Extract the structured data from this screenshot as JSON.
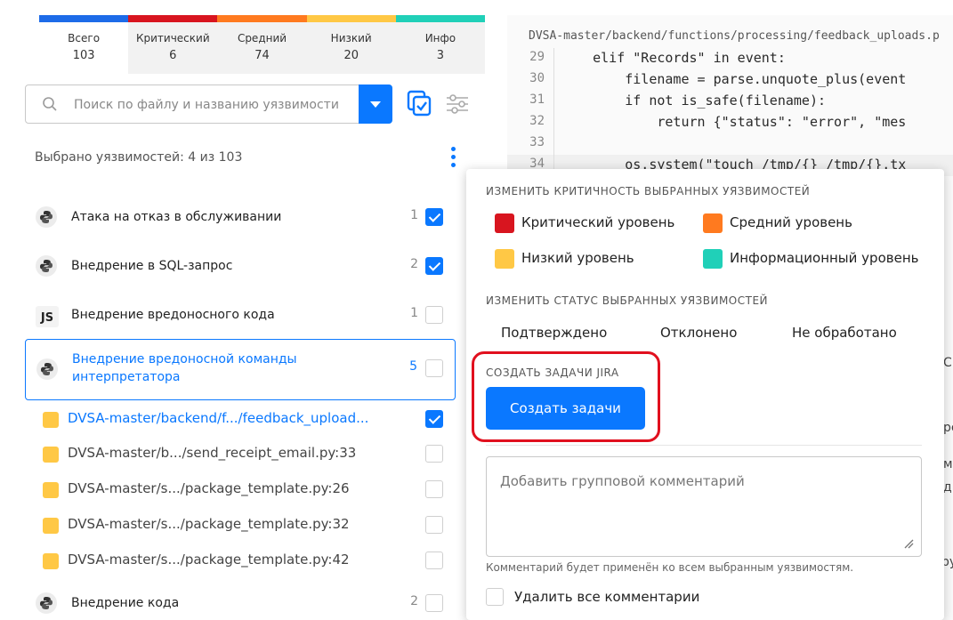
{
  "severity_tabs": [
    {
      "label": "Всего",
      "count": "103",
      "color": "#1d6be8"
    },
    {
      "label": "Критический",
      "count": "6",
      "color": "#d8151f"
    },
    {
      "label": "Средний",
      "count": "74",
      "color": "#ff7a1f"
    },
    {
      "label": "Низкий",
      "count": "20",
      "color": "#ffc845"
    },
    {
      "label": "Инфо",
      "count": "3",
      "color": "#20d0b8"
    }
  ],
  "search": {
    "placeholder": "Поиск по файлу и названию уязвимости"
  },
  "selected_info": "Выбрано уязвимостей: 4 из 103",
  "vulns": [
    {
      "name": "Атака на отказ в обслуживании",
      "count": "1",
      "icon": "python-icon",
      "checked": true
    },
    {
      "name": "Внедрение в SQL-запрос",
      "count": "2",
      "icon": "python-icon",
      "checked": true
    },
    {
      "name": "Внедрение вредоносного кода",
      "count": "1",
      "icon": "js-icon",
      "icon_text": "JS",
      "checked": false
    },
    {
      "name": "Внедрение вредоносной команды интерпретатора",
      "count": "5",
      "icon": "python-icon",
      "checked": false
    },
    {
      "name": "Внедрение кода",
      "count": "2",
      "icon": "python-icon",
      "checked": false
    }
  ],
  "files": [
    {
      "name": "DVSA-master/backend/f.../feedback_upload...",
      "checked": true
    },
    {
      "name": "DVSA-master/b.../send_receipt_email.py:33",
      "checked": false
    },
    {
      "name": "DVSA-master/s.../package_template.py:26",
      "checked": false
    },
    {
      "name": "DVSA-master/s.../package_template.py:32",
      "checked": false
    },
    {
      "name": "DVSA-master/s.../package_template.py:42",
      "checked": false
    }
  ],
  "code": {
    "path": "DVSA-master/backend/functions/processing/feedback_uploads.p",
    "lines": [
      {
        "num": "29",
        "text": "    elif \"Records\" in event:"
      },
      {
        "num": "30",
        "text": "        filename = parse.unquote_plus(event"
      },
      {
        "num": "31",
        "text": "        if not is_safe(filename):"
      },
      {
        "num": "32",
        "text": "            return {\"status\": \"error\", \"mes"
      },
      {
        "num": "33",
        "text": ""
      },
      {
        "num": "34",
        "text": "        os.system(\"touch /tmp/{} /tmp/{}.tx"
      }
    ]
  },
  "right_fragments": [
    "С",
    "ре",
    "м",
    "д",
    "ру"
  ],
  "menu": {
    "severity_title": "ИЗМЕНИТЬ КРИТИЧНОСТЬ ВЫБРАННЫХ УЯЗВИМОСТЕЙ",
    "levels": [
      {
        "label": "Критический уровень",
        "color": "#d8151f"
      },
      {
        "label": "Средний уровень",
        "color": "#ff7a1f"
      },
      {
        "label": "Низкий уровень",
        "color": "#ffc845"
      },
      {
        "label": "Информационный уровень",
        "color": "#20d0b8"
      }
    ],
    "status_title": "ИЗМЕНИТЬ СТАТУС ВЫБРАННЫХ УЯЗВИМОСТЕЙ",
    "statuses": [
      "Подтверждено",
      "Отклонено",
      "Не обработано"
    ],
    "jira_title": "СОЗДАТЬ ЗАДАЧИ JIRA",
    "create_button": "Создать задачи",
    "comment_placeholder": "Добавить групповой комментарий",
    "comment_hint": "Комментарий будет применён ко всем выбранным уязвимостям.",
    "delete_comments": "Удалить все комментарии"
  }
}
